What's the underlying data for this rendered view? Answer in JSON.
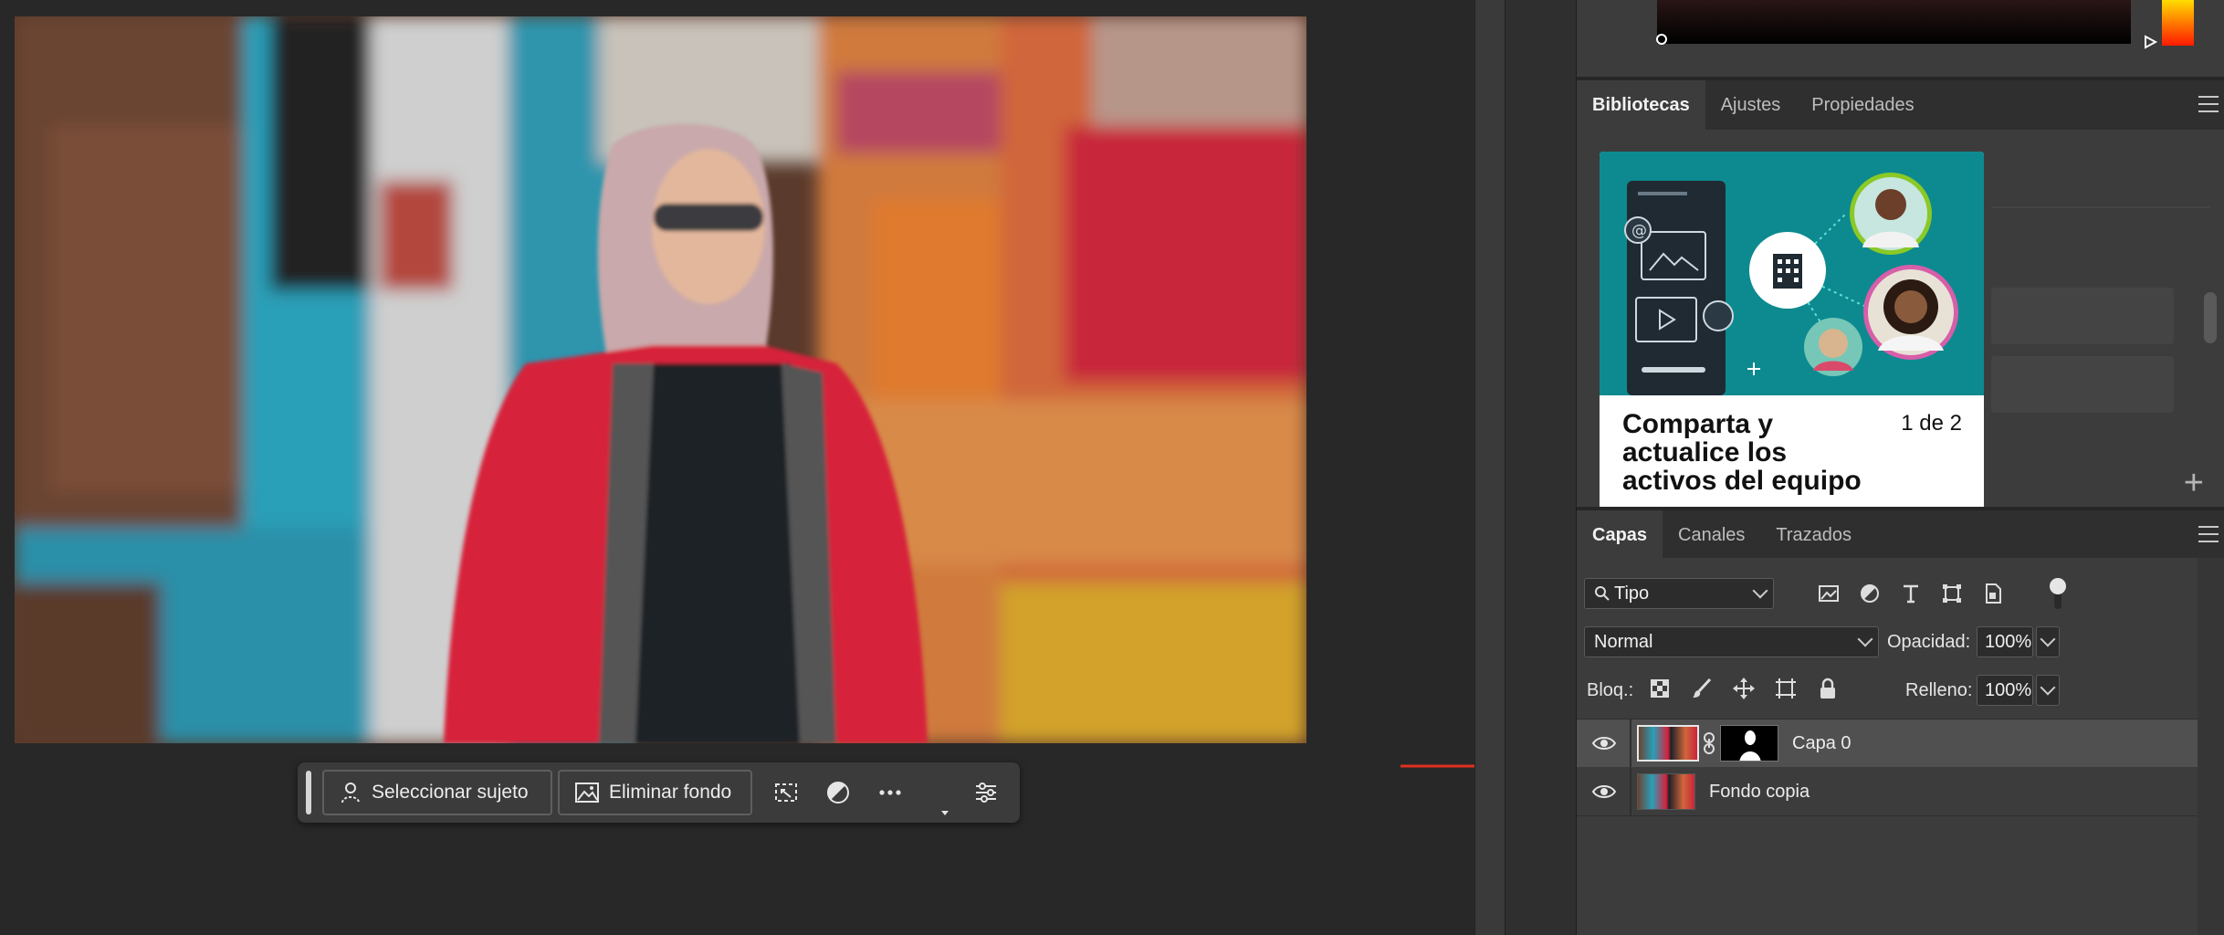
{
  "context_bar": {
    "select_subject_label": "Seleccionar sujeto",
    "remove_bg_label": "Eliminar fondo"
  },
  "libraries_panel": {
    "tabs": [
      "Bibliotecas",
      "Ajustes",
      "Propiedades"
    ],
    "promo_title": "Comparta y actualice los activos del equipo",
    "promo_count": "1 de 2"
  },
  "layers_panel": {
    "tabs": [
      "Capas",
      "Canales",
      "Trazados"
    ],
    "filter_value": "Tipo",
    "blend_mode": "Normal",
    "opacity_label": "Opacidad:",
    "opacity_value": "100%",
    "lock_label": "Bloq.:",
    "fill_label": "Relleno:",
    "fill_value": "100%",
    "layers": [
      {
        "name": "Capa 0",
        "selected": true,
        "has_mask": true
      },
      {
        "name": "Fondo copia",
        "selected": false,
        "has_mask": false
      }
    ]
  },
  "colors": {
    "arrow": "#e0301e",
    "panel_bg": "#3c3c3c",
    "canvas_bg": "#282828",
    "promo_teal": "#0d8a8f"
  }
}
